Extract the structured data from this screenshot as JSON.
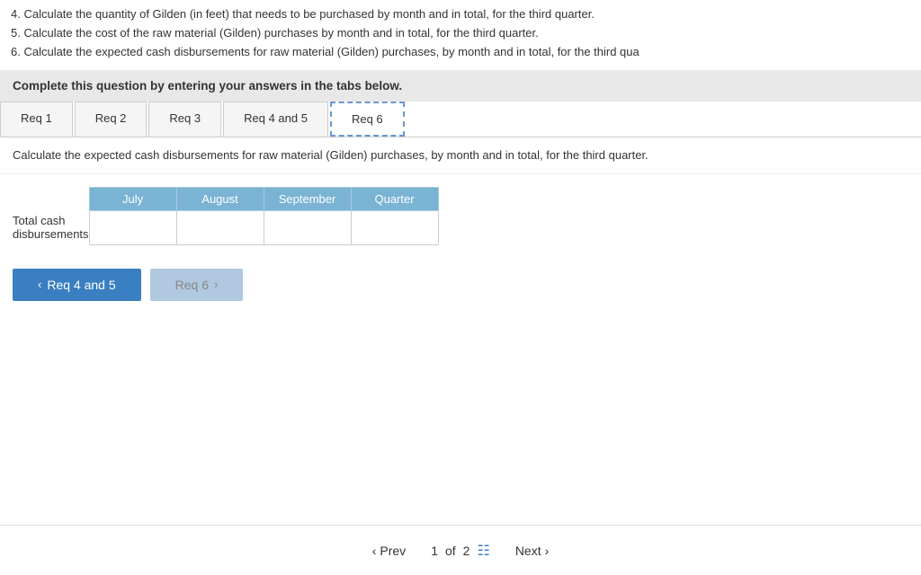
{
  "instructions": {
    "line1": "4. Calculate the quantity of Gilden (in feet) that needs to be purchased by month and in total, for the third quarter.",
    "line2": "5. Calculate the cost of the raw material (Gilden) purchases by month and in total, for the third quarter.",
    "line3": "6. Calculate the expected cash disbursements for raw material (Gilden) purchases, by month and in total, for the third qua"
  },
  "banner": "Complete this question by entering your answers in the tabs below.",
  "tabs": [
    {
      "label": "Req 1",
      "active": false
    },
    {
      "label": "Req 2",
      "active": false
    },
    {
      "label": "Req 3",
      "active": false
    },
    {
      "label": "Req 4 and 5",
      "active": false
    },
    {
      "label": "Req 6",
      "active": true
    }
  ],
  "question_text": "Calculate the expected cash disbursements for raw material (Gilden) purchases, by month and in total, for the third quarter.",
  "table": {
    "headers": [
      "",
      "July",
      "August",
      "September",
      "Quarter"
    ],
    "rows": [
      {
        "label": "Total cash disbursements",
        "july": "",
        "august": "",
        "september": "",
        "quarter": ""
      }
    ]
  },
  "nav_buttons": {
    "prev_label": "Req 4 and 5",
    "next_label": "Req 6"
  },
  "bottom_nav": {
    "prev_label": "Prev",
    "page_label": "1",
    "of_label": "of",
    "total_pages": "2",
    "next_label": "Next"
  }
}
